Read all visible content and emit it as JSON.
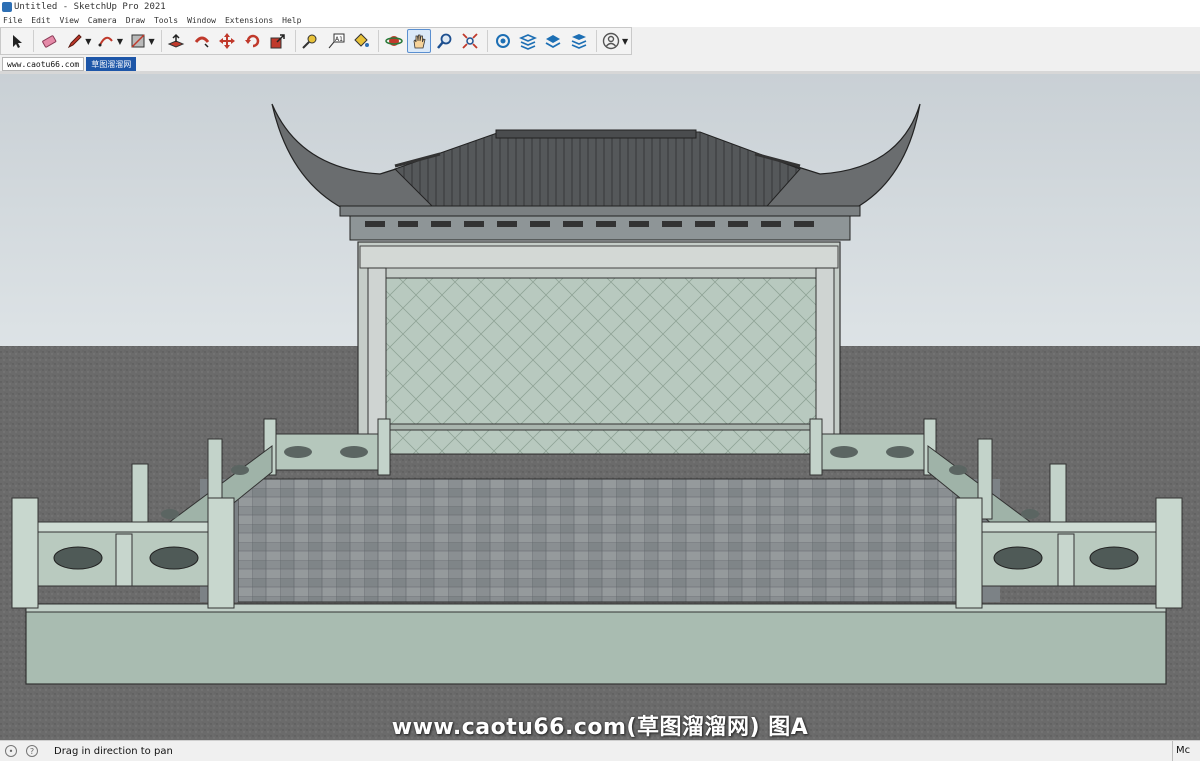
{
  "window": {
    "title": "Untitled - SketchUp Pro 2021"
  },
  "menu": [
    "File",
    "Edit",
    "View",
    "Camera",
    "Draw",
    "Tools",
    "Window",
    "Extensions",
    "Help"
  ],
  "toolbar": {
    "tools": [
      {
        "name": "select-tool",
        "icon": "arrow-cursor-icon"
      },
      {
        "name": "eraser-tool",
        "icon": "eraser-icon"
      },
      {
        "name": "line-tool",
        "icon": "pencil-icon"
      },
      {
        "name": "arc-tool",
        "icon": "arc-icon"
      },
      {
        "name": "rectangle-tool",
        "icon": "rectangle-icon"
      },
      {
        "name": "push-pull-tool",
        "icon": "push-pull-icon"
      },
      {
        "name": "follow-me-tool",
        "icon": "follow-me-icon"
      },
      {
        "name": "move-tool",
        "icon": "move-arrows-icon"
      },
      {
        "name": "rotate-tool",
        "icon": "rotate-icon"
      },
      {
        "name": "scale-tool",
        "icon": "scale-icon"
      },
      {
        "name": "tape-measure-tool",
        "icon": "tape-measure-icon"
      },
      {
        "name": "text-tool",
        "icon": "text-icon"
      },
      {
        "name": "paint-bucket-tool",
        "icon": "paint-bucket-icon"
      },
      {
        "name": "orbit-tool",
        "icon": "orbit-icon"
      },
      {
        "name": "pan-tool",
        "icon": "hand-icon"
      },
      {
        "name": "zoom-tool",
        "icon": "magnifier-icon"
      },
      {
        "name": "zoom-extents-tool",
        "icon": "zoom-extents-icon"
      },
      {
        "name": "warehouse-tool",
        "icon": "3d-warehouse-icon"
      },
      {
        "name": "extension-warehouse-tool",
        "icon": "extension-warehouse-icon"
      },
      {
        "name": "layout-tool",
        "icon": "layout-icon"
      },
      {
        "name": "extension-manager-tool",
        "icon": "extension-manager-icon"
      },
      {
        "name": "account-tool",
        "icon": "user-account-icon"
      }
    ],
    "active_tool": "pan-tool"
  },
  "tabs": [
    {
      "label": "www.caotu66.com",
      "active": false
    },
    {
      "label": "草图溜溜网",
      "active": true
    }
  ],
  "viewport": {
    "watermark": "www.caotu66.com(草图溜溜网) 图A",
    "sky_color": "#cfd6da",
    "ground_color": "#6a6a6a"
  },
  "status": {
    "hint": "Drag in direction to pan",
    "vcb_label": "Mc"
  }
}
